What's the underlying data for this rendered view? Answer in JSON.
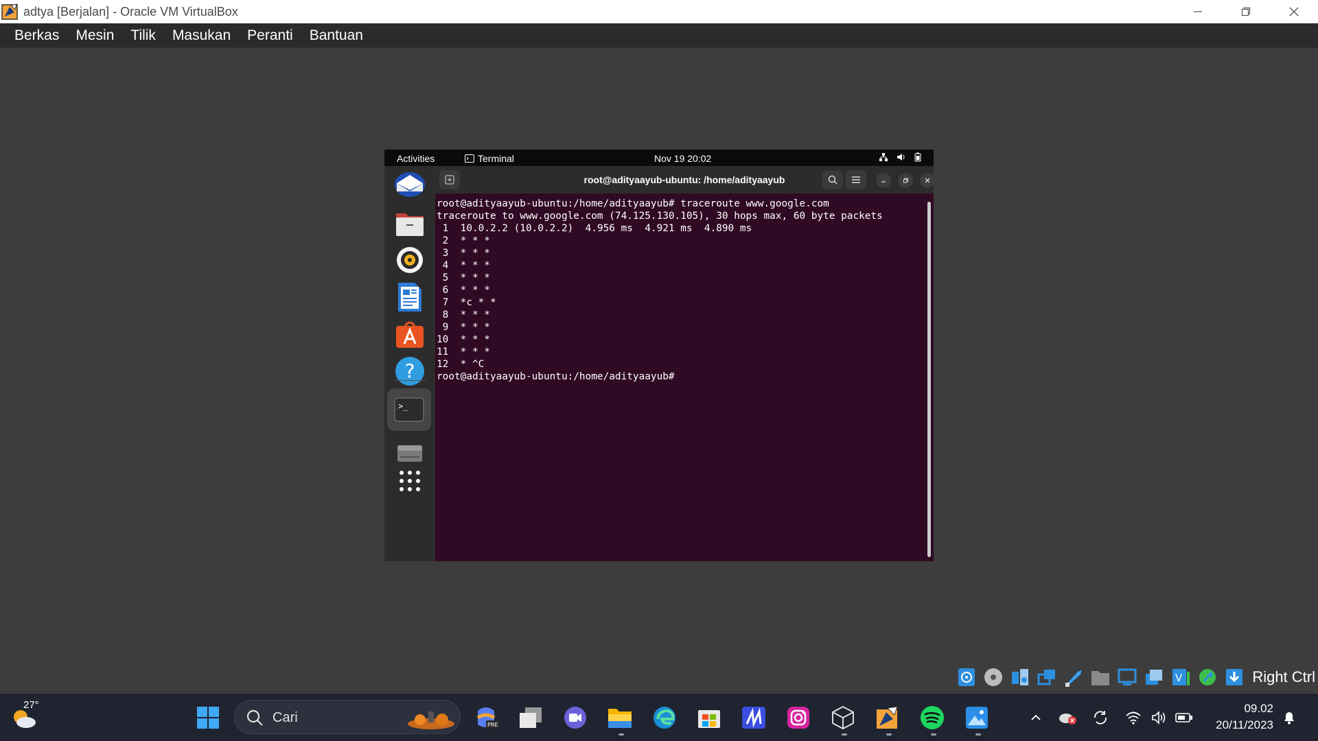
{
  "window": {
    "title": "adtya [Berjalan] - Oracle VM VirtualBox"
  },
  "menu": [
    "Berkas",
    "Mesin",
    "Tilik",
    "Masukan",
    "Peranti",
    "Bantuan"
  ],
  "gnome": {
    "activities": "Activities",
    "app_name": "Terminal",
    "clock": "Nov 19  20:02"
  },
  "terminal": {
    "title": "root@adityaayub-ubuntu: /home/adityaayub",
    "lines": [
      "root@adityaayub-ubuntu:/home/adityaayub# traceroute www.google.com",
      "traceroute to www.google.com (74.125.130.105), 30 hops max, 60 byte packets",
      " 1  10.0.2.2 (10.0.2.2)  4.956 ms  4.921 ms  4.890 ms",
      " 2  * * *",
      " 3  * * *",
      " 4  * * *",
      " 5  * * *",
      " 6  * * *",
      " 7  *c * *",
      " 8  * * *",
      " 9  * * *",
      "10  * * *",
      "11  * * *",
      "12  * ^C",
      "root@adityaayub-ubuntu:/home/adityaayub# "
    ]
  },
  "dock": [
    "thunderbird-icon",
    "files-icon",
    "rhythmbox-icon",
    "writer-icon",
    "software-icon",
    "help-icon",
    "terminal-icon",
    "drive-icon",
    "apps-grid-icon"
  ],
  "host_status": {
    "right_ctrl": "Right Ctrl"
  },
  "taskbar": {
    "weather_temp": "27°",
    "search_placeholder": "Cari",
    "time": "09.02",
    "date": "20/11/2023"
  },
  "colors": {
    "terminal_bg": "#300a24",
    "ubuntu_orange": "#e95420",
    "taskbar_bg": "#1f2430"
  }
}
